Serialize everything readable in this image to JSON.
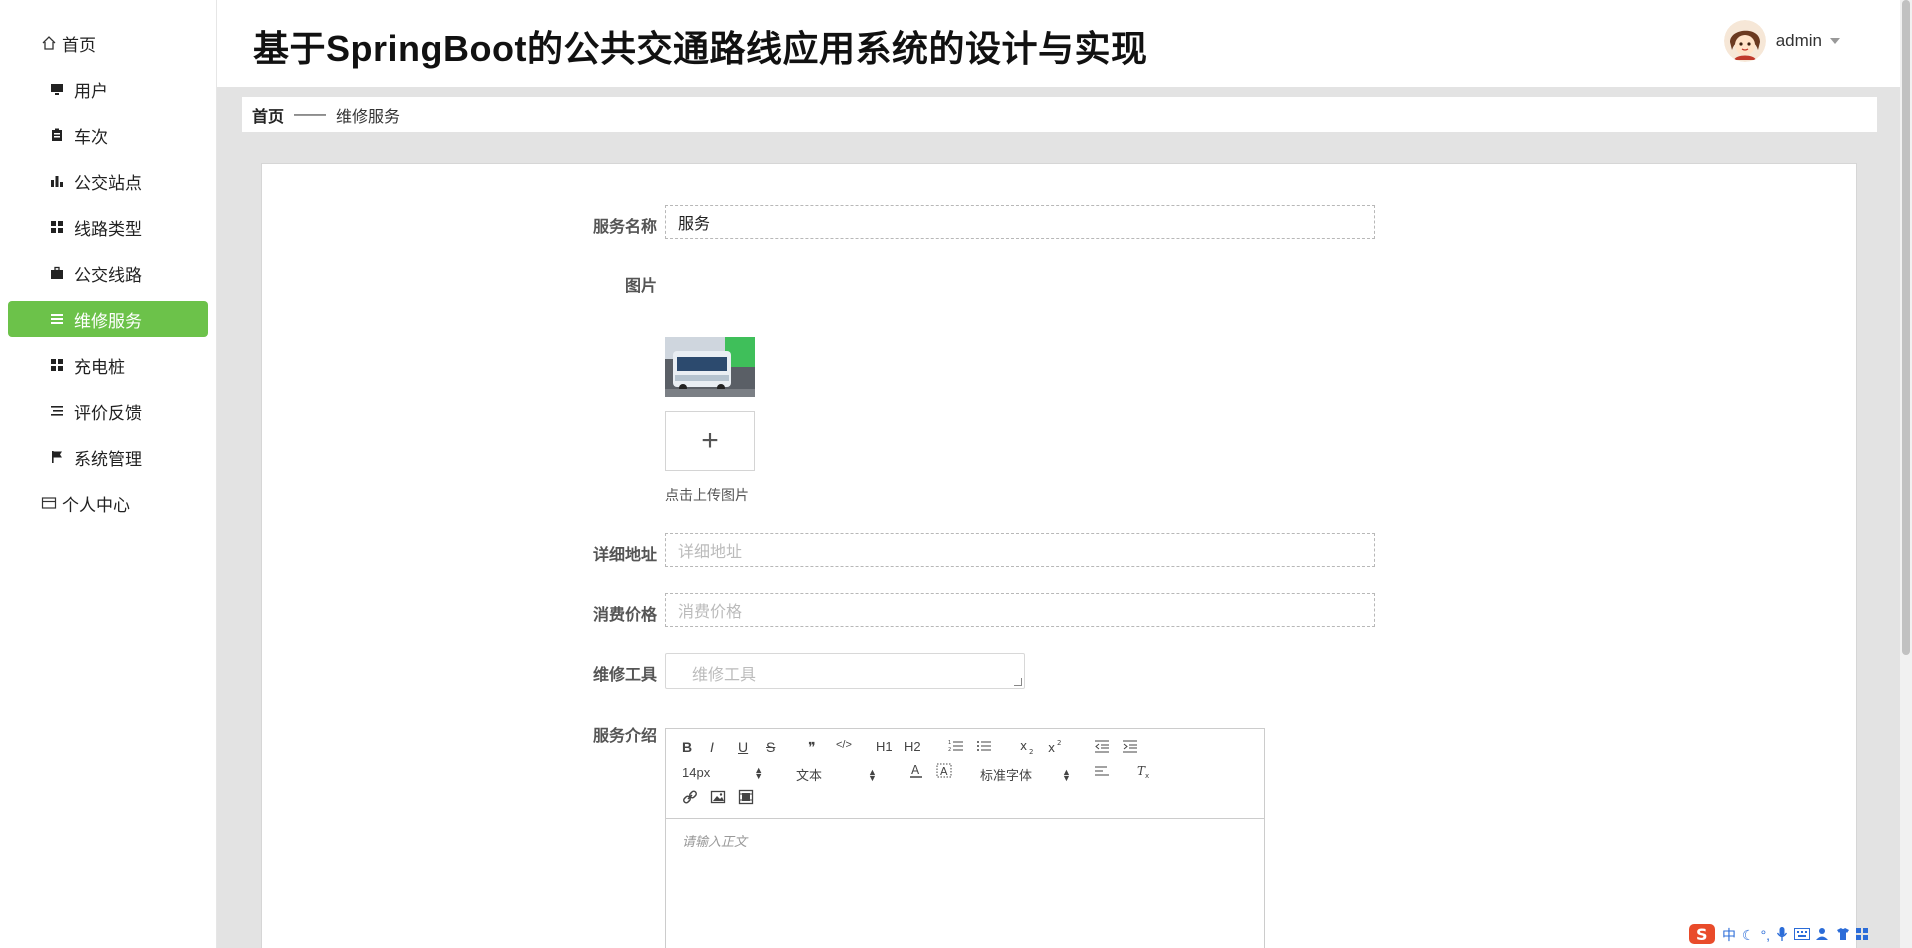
{
  "app": {
    "title": "基于SpringBoot的公共交通路线应用系统的设计与实现",
    "user": "admin"
  },
  "sidebar": {
    "items": [
      {
        "label": "首页",
        "icon": "home-icon"
      },
      {
        "label": "用户",
        "icon": "monitor-icon"
      },
      {
        "label": "车次",
        "icon": "clipboard-icon"
      },
      {
        "label": "公交站点",
        "icon": "bar-chart-icon"
      },
      {
        "label": "线路类型",
        "icon": "grid-icon"
      },
      {
        "label": "公交线路",
        "icon": "briefcase-icon"
      },
      {
        "label": "维修服务",
        "icon": "list-icon",
        "active": true
      },
      {
        "label": "充电桩",
        "icon": "grid-icon"
      },
      {
        "label": "评价反馈",
        "icon": "list-icon"
      },
      {
        "label": "系统管理",
        "icon": "flag-icon"
      },
      {
        "label": "个人中心",
        "icon": "card-icon"
      }
    ]
  },
  "breadcrumb": {
    "home": "首页",
    "separator": "——",
    "current": "维修服务"
  },
  "form": {
    "service_name": {
      "label": "服务名称",
      "value": "服务"
    },
    "image": {
      "label": "图片",
      "upload_tip": "点击上传图片",
      "plus": "+"
    },
    "address": {
      "label": "详细地址",
      "placeholder": "详细地址"
    },
    "price": {
      "label": "消费价格",
      "placeholder": "消费价格"
    },
    "tools": {
      "label": "维修工具",
      "placeholder": "维修工具"
    },
    "intro": {
      "label": "服务介绍",
      "placeholder": "请输入正文"
    }
  },
  "editor": {
    "font_size": "14px",
    "header_select": "文本",
    "font_family": "标准字体",
    "buttons": [
      "B",
      "I",
      "U",
      "S",
      "❞",
      "</>",
      "H1",
      "H2"
    ]
  },
  "ime": {
    "lang": "中"
  },
  "colors": {
    "accent": "#6cc24a",
    "background": "#e3e3e3"
  }
}
